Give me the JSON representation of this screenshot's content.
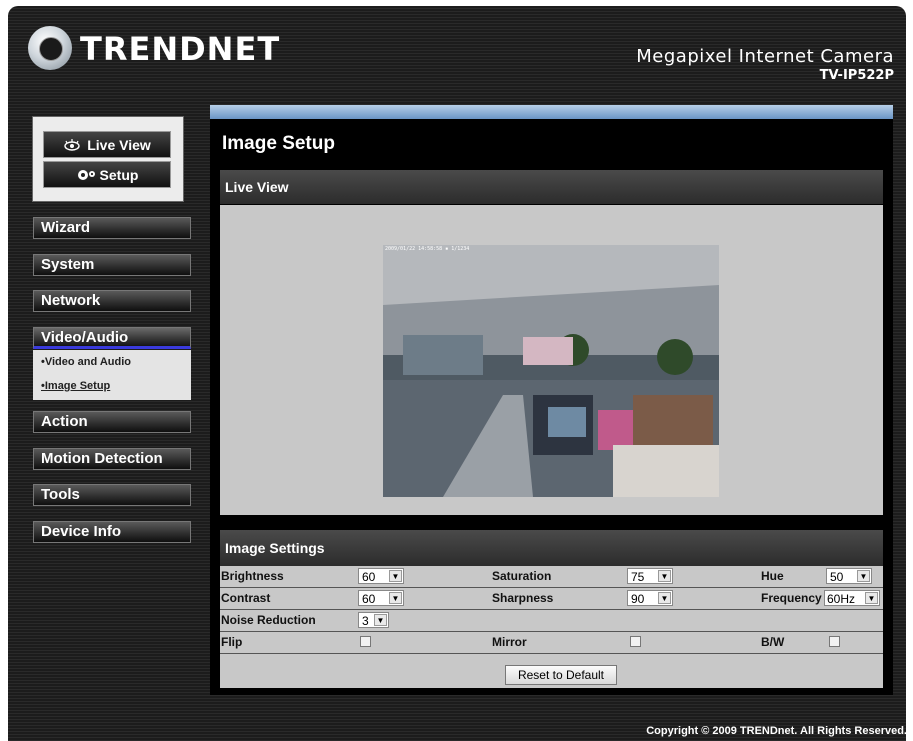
{
  "brand": {
    "logo": "TRENDNET",
    "product": "Megapixel Internet Camera",
    "model": "TV-IP522P"
  },
  "top_buttons": {
    "live_view": "Live View",
    "setup": "Setup"
  },
  "nav": {
    "items": [
      {
        "label": "Wizard"
      },
      {
        "label": "System"
      },
      {
        "label": "Network"
      },
      {
        "label": "Video/Audio"
      },
      {
        "label": "Action"
      },
      {
        "label": "Motion Detection"
      },
      {
        "label": "Tools"
      },
      {
        "label": "Device Info"
      }
    ],
    "sub_items": [
      {
        "label": "•Video and Audio"
      },
      {
        "label": "•Image Setup"
      }
    ]
  },
  "page": {
    "title": "Image Setup"
  },
  "live_view": {
    "header": "Live View",
    "timestamp": "2009/01/22 14:58:58 ▪ 1/1234"
  },
  "image_settings": {
    "header": "Image Settings",
    "brightness": {
      "label": "Brightness",
      "value": "60"
    },
    "saturation": {
      "label": "Saturation",
      "value": "75"
    },
    "hue": {
      "label": "Hue",
      "value": "50"
    },
    "contrast": {
      "label": "Contrast",
      "value": "60"
    },
    "sharpness": {
      "label": "Sharpness",
      "value": "90"
    },
    "frequency": {
      "label": "Frequency",
      "value": "60Hz"
    },
    "noise_reduction": {
      "label": "Noise Reduction",
      "value": "3"
    },
    "flip": {
      "label": "Flip",
      "checked": false
    },
    "mirror": {
      "label": "Mirror",
      "checked": false
    },
    "bw": {
      "label": "B/W",
      "checked": false
    },
    "reset_label": "Reset to Default"
  },
  "footer": {
    "copyright": "Copyright © 2009 TRENDnet. All Rights Reserved."
  }
}
